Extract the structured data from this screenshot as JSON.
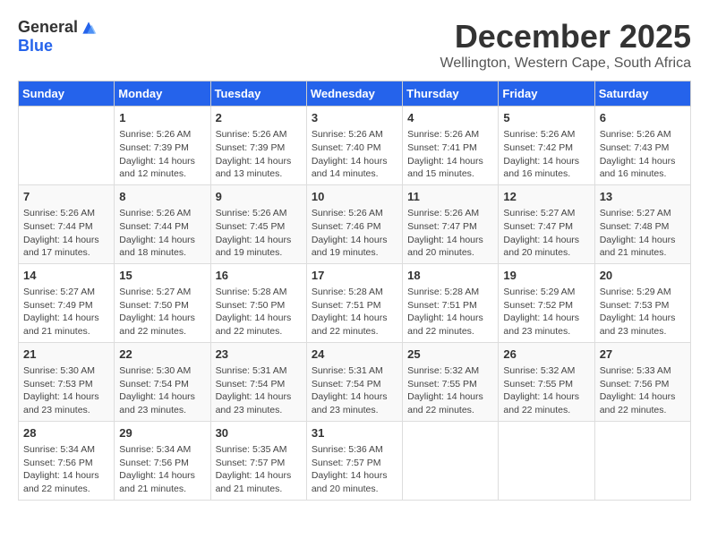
{
  "logo": {
    "general": "General",
    "blue": "Blue"
  },
  "title": "December 2025",
  "subtitle": "Wellington, Western Cape, South Africa",
  "days_header": [
    "Sunday",
    "Monday",
    "Tuesday",
    "Wednesday",
    "Thursday",
    "Friday",
    "Saturday"
  ],
  "weeks": [
    [
      {
        "day": "",
        "info": ""
      },
      {
        "day": "1",
        "info": "Sunrise: 5:26 AM\nSunset: 7:39 PM\nDaylight: 14 hours\nand 12 minutes."
      },
      {
        "day": "2",
        "info": "Sunrise: 5:26 AM\nSunset: 7:39 PM\nDaylight: 14 hours\nand 13 minutes."
      },
      {
        "day": "3",
        "info": "Sunrise: 5:26 AM\nSunset: 7:40 PM\nDaylight: 14 hours\nand 14 minutes."
      },
      {
        "day": "4",
        "info": "Sunrise: 5:26 AM\nSunset: 7:41 PM\nDaylight: 14 hours\nand 15 minutes."
      },
      {
        "day": "5",
        "info": "Sunrise: 5:26 AM\nSunset: 7:42 PM\nDaylight: 14 hours\nand 16 minutes."
      },
      {
        "day": "6",
        "info": "Sunrise: 5:26 AM\nSunset: 7:43 PM\nDaylight: 14 hours\nand 16 minutes."
      }
    ],
    [
      {
        "day": "7",
        "info": "Sunrise: 5:26 AM\nSunset: 7:44 PM\nDaylight: 14 hours\nand 17 minutes."
      },
      {
        "day": "8",
        "info": "Sunrise: 5:26 AM\nSunset: 7:44 PM\nDaylight: 14 hours\nand 18 minutes."
      },
      {
        "day": "9",
        "info": "Sunrise: 5:26 AM\nSunset: 7:45 PM\nDaylight: 14 hours\nand 19 minutes."
      },
      {
        "day": "10",
        "info": "Sunrise: 5:26 AM\nSunset: 7:46 PM\nDaylight: 14 hours\nand 19 minutes."
      },
      {
        "day": "11",
        "info": "Sunrise: 5:26 AM\nSunset: 7:47 PM\nDaylight: 14 hours\nand 20 minutes."
      },
      {
        "day": "12",
        "info": "Sunrise: 5:27 AM\nSunset: 7:47 PM\nDaylight: 14 hours\nand 20 minutes."
      },
      {
        "day": "13",
        "info": "Sunrise: 5:27 AM\nSunset: 7:48 PM\nDaylight: 14 hours\nand 21 minutes."
      }
    ],
    [
      {
        "day": "14",
        "info": "Sunrise: 5:27 AM\nSunset: 7:49 PM\nDaylight: 14 hours\nand 21 minutes."
      },
      {
        "day": "15",
        "info": "Sunrise: 5:27 AM\nSunset: 7:50 PM\nDaylight: 14 hours\nand 22 minutes."
      },
      {
        "day": "16",
        "info": "Sunrise: 5:28 AM\nSunset: 7:50 PM\nDaylight: 14 hours\nand 22 minutes."
      },
      {
        "day": "17",
        "info": "Sunrise: 5:28 AM\nSunset: 7:51 PM\nDaylight: 14 hours\nand 22 minutes."
      },
      {
        "day": "18",
        "info": "Sunrise: 5:28 AM\nSunset: 7:51 PM\nDaylight: 14 hours\nand 22 minutes."
      },
      {
        "day": "19",
        "info": "Sunrise: 5:29 AM\nSunset: 7:52 PM\nDaylight: 14 hours\nand 23 minutes."
      },
      {
        "day": "20",
        "info": "Sunrise: 5:29 AM\nSunset: 7:53 PM\nDaylight: 14 hours\nand 23 minutes."
      }
    ],
    [
      {
        "day": "21",
        "info": "Sunrise: 5:30 AM\nSunset: 7:53 PM\nDaylight: 14 hours\nand 23 minutes."
      },
      {
        "day": "22",
        "info": "Sunrise: 5:30 AM\nSunset: 7:54 PM\nDaylight: 14 hours\nand 23 minutes."
      },
      {
        "day": "23",
        "info": "Sunrise: 5:31 AM\nSunset: 7:54 PM\nDaylight: 14 hours\nand 23 minutes."
      },
      {
        "day": "24",
        "info": "Sunrise: 5:31 AM\nSunset: 7:54 PM\nDaylight: 14 hours\nand 23 minutes."
      },
      {
        "day": "25",
        "info": "Sunrise: 5:32 AM\nSunset: 7:55 PM\nDaylight: 14 hours\nand 22 minutes."
      },
      {
        "day": "26",
        "info": "Sunrise: 5:32 AM\nSunset: 7:55 PM\nDaylight: 14 hours\nand 22 minutes."
      },
      {
        "day": "27",
        "info": "Sunrise: 5:33 AM\nSunset: 7:56 PM\nDaylight: 14 hours\nand 22 minutes."
      }
    ],
    [
      {
        "day": "28",
        "info": "Sunrise: 5:34 AM\nSunset: 7:56 PM\nDaylight: 14 hours\nand 22 minutes."
      },
      {
        "day": "29",
        "info": "Sunrise: 5:34 AM\nSunset: 7:56 PM\nDaylight: 14 hours\nand 21 minutes."
      },
      {
        "day": "30",
        "info": "Sunrise: 5:35 AM\nSunset: 7:57 PM\nDaylight: 14 hours\nand 21 minutes."
      },
      {
        "day": "31",
        "info": "Sunrise: 5:36 AM\nSunset: 7:57 PM\nDaylight: 14 hours\nand 20 minutes."
      },
      {
        "day": "",
        "info": ""
      },
      {
        "day": "",
        "info": ""
      },
      {
        "day": "",
        "info": ""
      }
    ]
  ]
}
